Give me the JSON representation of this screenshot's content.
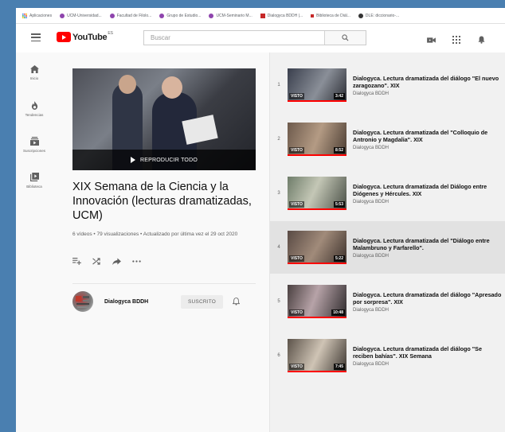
{
  "bookmarks": [
    {
      "label": "Aplicaciones",
      "color": "#4285f4",
      "shape": "grid"
    },
    {
      "label": "UCM-Universidad...",
      "color": "#8e44ad",
      "shape": "dot"
    },
    {
      "label": "Facultad de Filolo...",
      "color": "#8e44ad",
      "shape": "dot"
    },
    {
      "label": "Grupo de Estudio...",
      "color": "#8e44ad",
      "shape": "dot"
    },
    {
      "label": "UCM-Seminario M...",
      "color": "#8e44ad",
      "shape": "dot"
    },
    {
      "label": "Dialogyca BDDH |...",
      "color": "#c62828",
      "shape": "square"
    },
    {
      "label": "Biblioteca de Diál...",
      "color": "#c62828",
      "shape": "small"
    },
    {
      "label": "DLE: diccionario-...",
      "color": "#333333",
      "shape": "dot"
    }
  ],
  "header": {
    "logo_text": "YouTube",
    "region": "ES",
    "search_placeholder": "Buscar"
  },
  "sidebar": {
    "items": [
      {
        "label": "Inicio",
        "icon": "home-icon"
      },
      {
        "label": "Tendencias",
        "icon": "trending-icon"
      },
      {
        "label": "Suscripciones",
        "icon": "subscriptions-icon"
      },
      {
        "label": "Biblioteca",
        "icon": "library-icon"
      }
    ]
  },
  "playlist": {
    "play_all_label": "REPRODUCIR TODO",
    "title": "XIX Semana de la Ciencia y la Innovación (lecturas dramatizadas, UCM)",
    "stats": "6 vídeos • 79 visualizaciones • Actualizado por última vez el 29 oct 2020",
    "owner_name": "Dialogyca BDDH",
    "subscribe_label": "SUSCRITO"
  },
  "videos": [
    {
      "index": "1",
      "title": "Dialogyca. Lectura dramatizada del diálogo \"El nuevo zaragozano\". XIX",
      "channel": "Dialogyca BDDH",
      "watched": "VISTO",
      "duration": "3:42"
    },
    {
      "index": "2",
      "title": "Dialogyca. Lectura dramatizada del \"Colloquio de Antronio y Magdalia\". XIX",
      "channel": "Dialogyca BDDH",
      "watched": "VISTO",
      "duration": "8:52"
    },
    {
      "index": "3",
      "title": "Dialogyca. Lectura dramatizada del Diálogo entre Diógenes y Hércules. XIX",
      "channel": "Dialogyca BDDH",
      "watched": "VISTO",
      "duration": "5:53"
    },
    {
      "index": "4",
      "title": "Dialogyca. Lectura dramatizada del \"Diálogo entre Malambruno y Farfarello\".",
      "channel": "Dialogyca BDDH",
      "watched": "VISTO",
      "duration": "5:22"
    },
    {
      "index": "5",
      "title": "Dialogyca. Lectura dramatizada del diálogo \"Apresado por sorpresa\". XIX",
      "channel": "Dialogyca BDDH",
      "watched": "VISTO",
      "duration": "10:48"
    },
    {
      "index": "6",
      "title": "Dialogyca. Lectura dramatizada del diálogo \"Se reciben bahías\". XIX Semana",
      "channel": "Dialogyca BDDH",
      "watched": "VISTO",
      "duration": "7:45"
    }
  ],
  "colors": {
    "brand_red": "#ff0000",
    "active_row": "#e2e2e2",
    "list_bg": "#f1f1f1"
  }
}
